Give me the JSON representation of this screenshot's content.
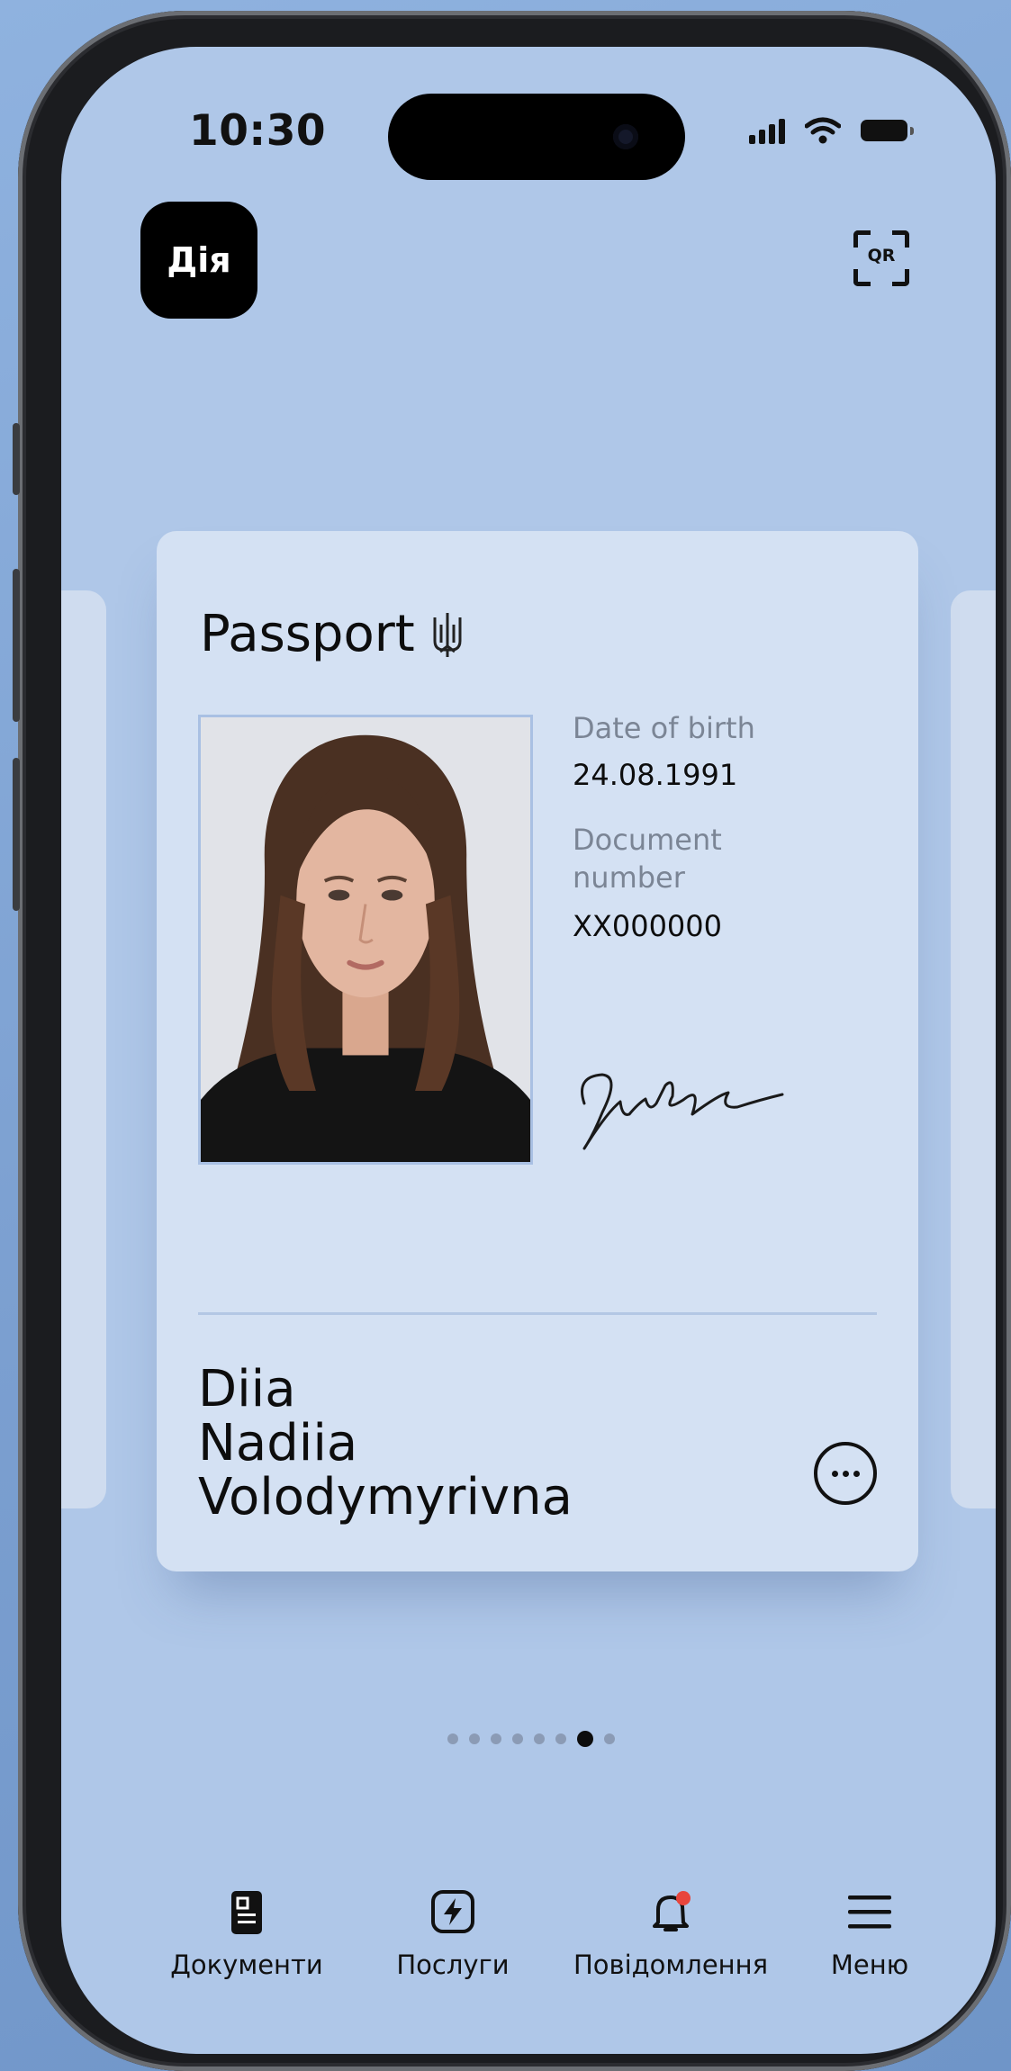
{
  "status_bar": {
    "time": "10:30"
  },
  "header": {
    "app_logo_text": "Дія",
    "qr_label": "QR"
  },
  "document": {
    "title": "Passport",
    "fields": [
      {
        "label": "Date of birth",
        "value": "24.08.1991"
      },
      {
        "label": "Document number",
        "value": "XX000000"
      }
    ],
    "name_lines": [
      "Diia",
      "Nadiia",
      "Volodymyrivna"
    ]
  },
  "pagination": {
    "total": 8,
    "active_index": 6
  },
  "tab_bar": {
    "items": [
      {
        "label": "Документи",
        "icon": "document-icon"
      },
      {
        "label": "Послуги",
        "icon": "lightning-icon"
      },
      {
        "label": "Повідомлення",
        "icon": "bell-icon",
        "has_badge": true
      },
      {
        "label": "Меню",
        "icon": "menu-icon"
      }
    ]
  },
  "colors": {
    "screen_background": "#afc7e8",
    "card_background": "#d4e1f3",
    "notification_badge": "#e8453c"
  }
}
